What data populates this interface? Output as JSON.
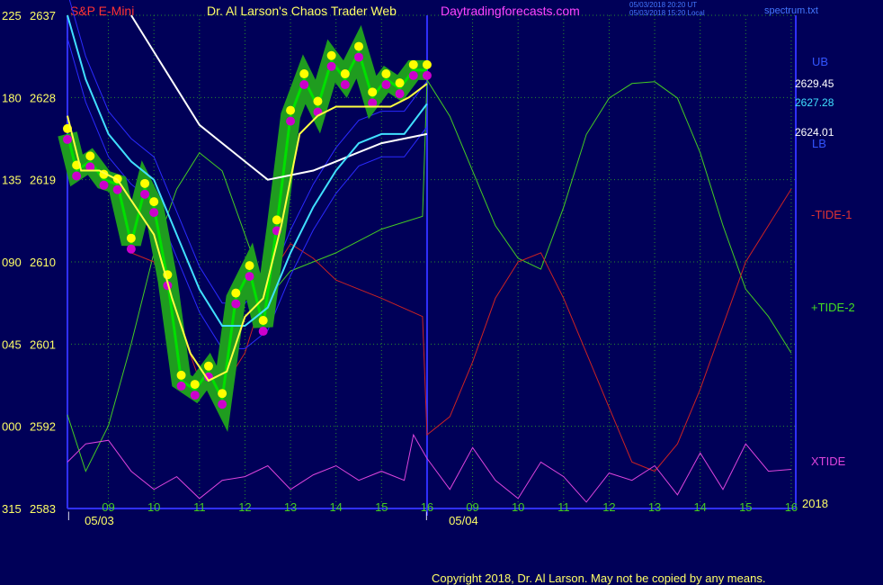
{
  "header": {
    "symbol": "S&P E-Mini",
    "title": "Dr. Al Larson's Chaos Trader Web",
    "site": "Daytradingforecasts.com",
    "timestamp_utc": "05/03/2018 20:20 UT",
    "timestamp_local": "05/03/2018 15:20 Local",
    "file": "spectrum.txt",
    "copyright": "Copyright 2018, Dr. Al Larson. May not be copied by any means."
  },
  "colors": {
    "background": "#000058",
    "grid": "#2a8c2a",
    "axis": "#3030ff",
    "price_band": "#1f9c1f",
    "price_line": "#00e000",
    "ema_fast": "#ffff40",
    "ema_mid": "#40e0ff",
    "ema_slow": "#ffffff",
    "band": "#2a2aff",
    "tide_plus": "#44cc22",
    "tide_minus": "#cc2222",
    "xtide": "#dd44dd",
    "high_dot": "#ffff00",
    "low_dot": "#cc00cc"
  },
  "chart_data": {
    "type": "line",
    "x_unit": "hour",
    "price_axis": {
      "ticks": [
        2583,
        2592,
        2601,
        2610,
        2619,
        2628,
        2637
      ],
      "ylim": [
        2583,
        2637
      ]
    },
    "osc_axis": {
      "ticks": [
        "315",
        "000",
        "045",
        "090",
        "135",
        "180",
        "225"
      ]
    },
    "x_ticks": [
      {
        "x": 9,
        "label": "09"
      },
      {
        "x": 10,
        "label": "10"
      },
      {
        "x": 11,
        "label": "11"
      },
      {
        "x": 12,
        "label": "12"
      },
      {
        "x": 13,
        "label": "13"
      },
      {
        "x": 14,
        "label": "14"
      },
      {
        "x": 15,
        "label": "15"
      },
      {
        "x": 16,
        "label": "16"
      },
      {
        "x": 17,
        "label": "09"
      },
      {
        "x": 18,
        "label": "10"
      },
      {
        "x": 19,
        "label": "11"
      },
      {
        "x": 20,
        "label": "12"
      },
      {
        "x": 21,
        "label": "13"
      },
      {
        "x": 22,
        "label": "14"
      },
      {
        "x": 23,
        "label": "15"
      },
      {
        "x": 24,
        "label": "16"
      }
    ],
    "year_label": "2018",
    "x_range": [
      8.1,
      24.1
    ],
    "date_labels": [
      {
        "x": 8.8,
        "label": "05/03"
      },
      {
        "x": 16.8,
        "label": "05/04"
      }
    ],
    "session_break_x": 16,
    "right_labels": {
      "ub": "UB",
      "lb": "LB",
      "price_high": "2629.45",
      "price_mid": "2627.28",
      "price_low": "2624.01",
      "tide_minus": "-TIDE-1",
      "tide_plus": "+TIDE-2",
      "xtide": "XTIDE"
    },
    "series": [
      {
        "name": "price",
        "x": [
          8.1,
          8.3,
          8.6,
          8.9,
          9.2,
          9.5,
          9.8,
          10.0,
          10.3,
          10.6,
          10.9,
          11.2,
          11.5,
          11.8,
          12.1,
          12.4,
          12.7,
          13.0,
          13.3,
          13.6,
          13.9,
          14.2,
          14.5,
          14.8,
          15.1,
          15.4,
          15.7,
          16.0
        ],
        "y": [
          2624,
          2620,
          2621,
          2619,
          2618.5,
          2612,
          2618,
          2616,
          2608,
          2597,
          2596,
          2598,
          2595,
          2606,
          2609,
          2603,
          2614,
          2626,
          2630,
          2627,
          2632,
          2630,
          2633,
          2628,
          2630,
          2629,
          2631,
          2631
        ]
      },
      {
        "name": "ema_fast",
        "x": [
          8.1,
          8.4,
          8.8,
          9.2,
          9.6,
          10.0,
          10.4,
          10.8,
          11.2,
          11.6,
          12.0,
          12.4,
          12.8,
          13.2,
          13.6,
          14.0,
          14.4,
          14.8,
          15.2,
          15.6,
          16.0
        ],
        "y": [
          2626,
          2620,
          2620,
          2619,
          2616,
          2613,
          2606,
          2600,
          2597,
          2598,
          2604,
          2606,
          2614,
          2624,
          2626,
          2627,
          2627,
          2627,
          2627,
          2628,
          2629.5
        ]
      },
      {
        "name": "ema_mid",
        "x": [
          8.1,
          8.5,
          9.0,
          9.5,
          10.0,
          10.5,
          11.0,
          11.5,
          12.0,
          12.5,
          13.0,
          13.5,
          14.0,
          14.5,
          15.0,
          15.5,
          16.0
        ],
        "y": [
          2637,
          2630,
          2624,
          2621,
          2619,
          2613,
          2607,
          2603,
          2603,
          2605,
          2611,
          2616,
          2620,
          2623,
          2624,
          2624,
          2627.3
        ]
      },
      {
        "name": "ema_slow",
        "x": [
          9.5,
          10.0,
          10.5,
          11.0,
          11.5,
          12.0,
          12.5,
          13.0,
          13.5,
          14.0,
          14.5,
          15.0,
          15.5,
          16.0
        ],
        "y": [
          2637,
          2633,
          2629,
          2625,
          2623,
          2621,
          2619,
          2619.5,
          2620,
          2621,
          2622,
          2623,
          2623.5,
          2624
        ]
      },
      {
        "name": "tide_plus",
        "x": [
          8.1,
          8.5,
          9.0,
          9.5,
          10.0,
          10.5,
          11.0,
          11.5,
          12.0,
          12.5,
          13.0,
          13.5,
          14.0,
          15.0,
          15.9,
          16.0,
          16.5,
          17.0,
          17.5,
          18.0,
          18.5,
          19.0,
          19.5,
          20.0,
          20.5,
          21.0,
          21.5,
          22.0,
          22.5,
          23.0,
          23.5,
          24.0
        ],
        "y": [
          6,
          -25,
          0,
          45,
          95,
          130,
          150,
          140,
          105,
          70,
          85,
          90,
          95,
          108,
          115,
          190,
          170,
          140,
          110,
          92,
          86,
          120,
          160,
          180,
          188,
          189,
          180,
          150,
          110,
          75,
          60,
          40
        ]
      },
      {
        "name": "tide_minus",
        "x": [
          9.5,
          10.0,
          10.5,
          11.0,
          11.5,
          12.0,
          12.5,
          13.0,
          13.5,
          14.0,
          15.0,
          15.9,
          16.0,
          16.5,
          17.0,
          17.5,
          18.0,
          18.5,
          19.0,
          19.5,
          20.0,
          20.5,
          21.0,
          21.5,
          22.0,
          22.5,
          23.0,
          24.0
        ],
        "y": [
          95,
          90,
          60,
          25,
          20,
          40,
          80,
          100,
          92,
          80,
          70,
          60,
          -5,
          5,
          35,
          70,
          90,
          95,
          70,
          40,
          10,
          -20,
          -25,
          -10,
          20,
          55,
          90,
          130
        ]
      },
      {
        "name": "xtide",
        "x": [
          8.1,
          8.5,
          9.0,
          9.5,
          10.0,
          10.5,
          11.0,
          11.5,
          12.0,
          12.5,
          13.0,
          13.5,
          14.0,
          14.5,
          15.0,
          15.5,
          15.7,
          16.0,
          16.5,
          17.0,
          17.5,
          18.0,
          18.5,
          19.0,
          19.5,
          20.0,
          20.5,
          21.0,
          21.5,
          22.0,
          22.5,
          23.0,
          23.5,
          24.0
        ],
        "y": [
          -20,
          -10,
          -8,
          -25,
          -35,
          -28,
          -40,
          -30,
          -28,
          -22,
          -35,
          -27,
          -22,
          -30,
          -25,
          -30,
          -5,
          -18,
          -35,
          -12,
          -30,
          -40,
          -20,
          -28,
          -42,
          -26,
          -30,
          -22,
          -38,
          -15,
          -35,
          -10,
          -25,
          -24
        ]
      }
    ]
  }
}
